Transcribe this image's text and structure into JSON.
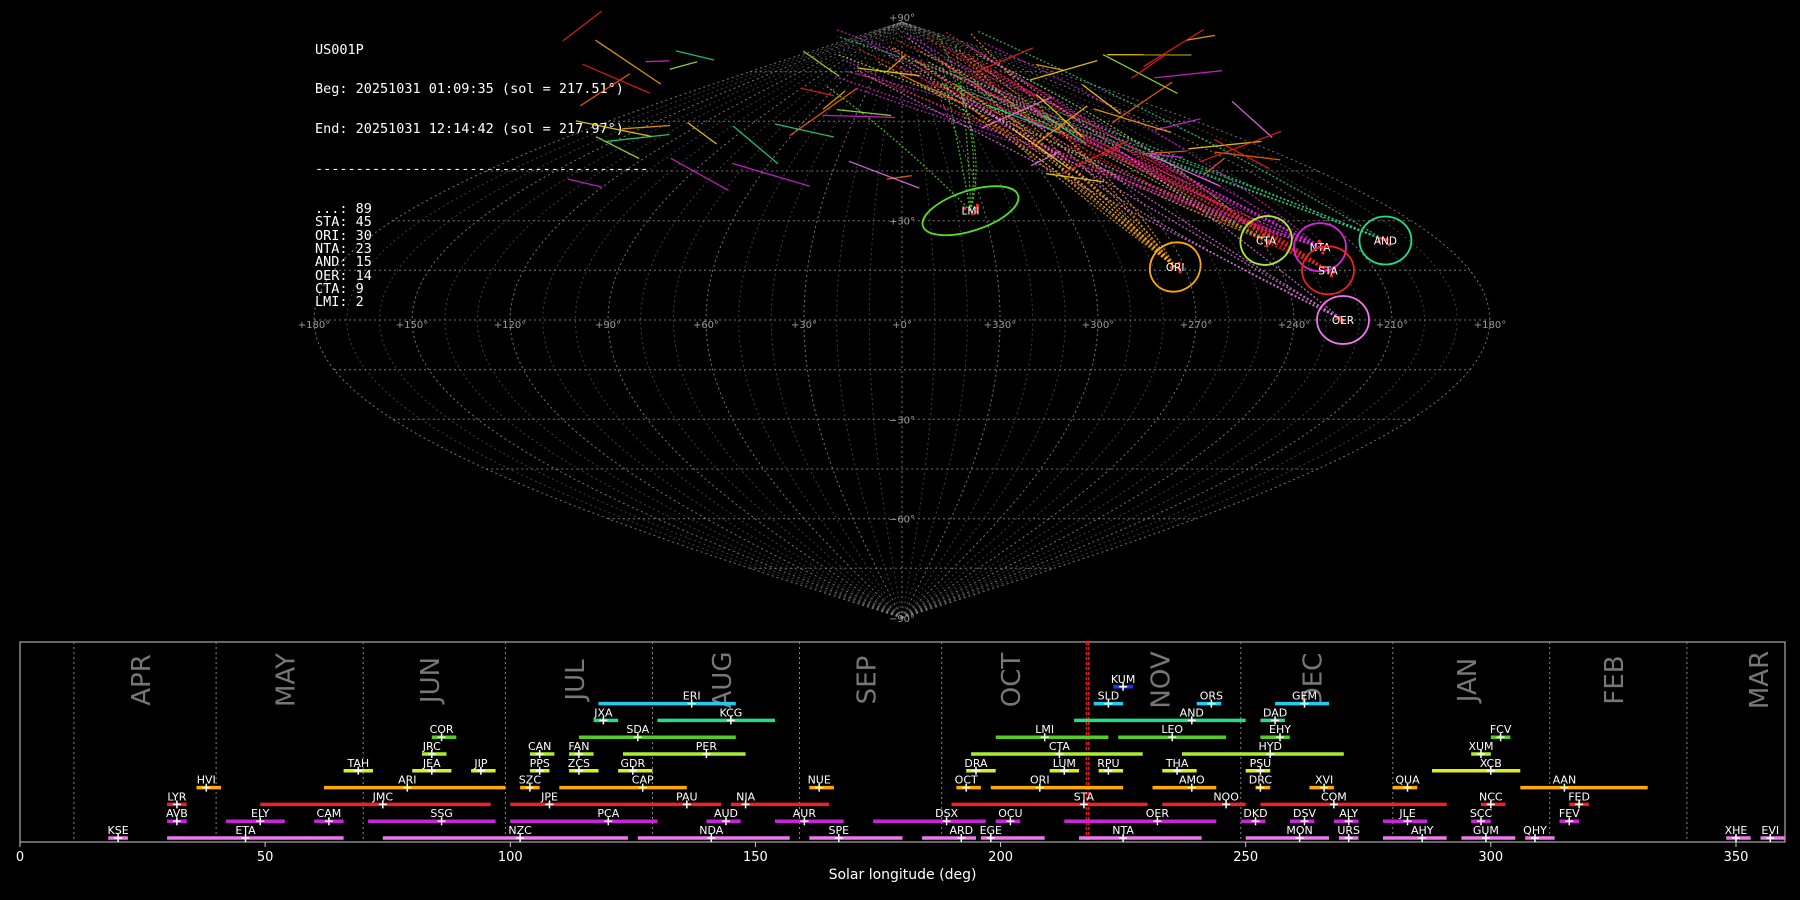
{
  "header": {
    "station": "US001P",
    "begin": "Beg: 20251031 01:09:35 (sol = 217.51°)",
    "end": "End: 20251031 12:14:42 (sol = 217.97°)",
    "separator": "-----------------------------------------",
    "counts": [
      {
        "code": "...",
        "count": 89
      },
      {
        "code": "STA",
        "count": 45
      },
      {
        "code": "ORI",
        "count": 30
      },
      {
        "code": "NTA",
        "count": 23
      },
      {
        "code": "AND",
        "count": 15
      },
      {
        "code": "OER",
        "count": 14
      },
      {
        "code": "CTA",
        "count": 9
      },
      {
        "code": "LMI",
        "count": 2
      }
    ]
  },
  "sky_map": {
    "projection": "sinusoidal",
    "longitude_ticks": [
      "+180°",
      "+150°",
      "+120°",
      "+90°",
      "+60°",
      "+30°",
      "+0°",
      "+330°",
      "+300°",
      "+270°",
      "+240°",
      "+210°",
      "+180°"
    ],
    "latitude_ticks": [
      "+90°",
      "+30°",
      "−30°",
      "−60°",
      "−90°"
    ],
    "radiants": [
      {
        "code": "LMI",
        "lon": 155,
        "lat": 33,
        "color": "#55dd22"
      },
      {
        "code": "ORI",
        "lon": 93,
        "lat": 16,
        "color": "#ffaa00"
      },
      {
        "code": "CTA",
        "lon": 58,
        "lat": 24,
        "color": "#aaee33"
      },
      {
        "code": "NTA",
        "lon": 42,
        "lat": 22,
        "color": "#dd22dd"
      },
      {
        "code": "STA",
        "lon": 45,
        "lat": 15,
        "color": "#ee2222"
      },
      {
        "code": "AND",
        "lon": 18,
        "lat": 24,
        "color": "#22dd88"
      },
      {
        "code": "OER",
        "lon": 45,
        "lat": 0,
        "color": "#ee77ee"
      }
    ]
  },
  "chart_data": {
    "type": "timeline",
    "xlabel": "Solar longitude (deg)",
    "xlim": [
      0,
      360
    ],
    "xticks": [
      0,
      50,
      100,
      150,
      200,
      250,
      300,
      350
    ],
    "current_sol": [
      217.51,
      217.97
    ],
    "months": [
      {
        "label": "APR",
        "start": 11
      },
      {
        "label": "MAY",
        "start": 40
      },
      {
        "label": "JUN",
        "start": 70
      },
      {
        "label": "JUL",
        "start": 99
      },
      {
        "label": "AUG",
        "start": 129
      },
      {
        "label": "SEP",
        "start": 159
      },
      {
        "label": "OCT",
        "start": 188
      },
      {
        "label": "NOV",
        "start": 218
      },
      {
        "label": "DEC",
        "start": 249
      },
      {
        "label": "JAN",
        "start": 280
      },
      {
        "label": "FEB",
        "start": 312
      },
      {
        "label": "MAR",
        "start": 340
      }
    ],
    "showers": [
      {
        "code": "KUM",
        "start": 223,
        "end": 227,
        "peak": 225,
        "row": 10,
        "color": "#2233ff"
      },
      {
        "code": "ERI",
        "start": 118,
        "end": 146,
        "peak": 137,
        "row": 9,
        "color": "#22ccee"
      },
      {
        "code": "SLD",
        "start": 219,
        "end": 225,
        "peak": 222,
        "row": 9,
        "color": "#22ccee"
      },
      {
        "code": "ORS",
        "start": 240,
        "end": 245,
        "peak": 243,
        "row": 9,
        "color": "#22ccee"
      },
      {
        "code": "GEM",
        "start": 256,
        "end": 267,
        "peak": 262,
        "row": 9,
        "color": "#22ccee"
      },
      {
        "code": "JXA",
        "start": 117,
        "end": 122,
        "peak": 119,
        "row": 8,
        "color": "#22dd88"
      },
      {
        "code": "KCG",
        "start": 130,
        "end": 154,
        "peak": 145,
        "row": 8,
        "color": "#22dd88"
      },
      {
        "code": "AND",
        "start": 215,
        "end": 250,
        "peak": 239,
        "row": 8,
        "color": "#22dd88"
      },
      {
        "code": "DAD",
        "start": 253,
        "end": 258,
        "peak": 256,
        "row": 8,
        "color": "#22dd88"
      },
      {
        "code": "COR",
        "start": 84,
        "end": 89,
        "peak": 86,
        "row": 7,
        "color": "#55cc22"
      },
      {
        "code": "SDA",
        "start": 114,
        "end": 146,
        "peak": 126,
        "row": 7,
        "color": "#55cc22"
      },
      {
        "code": "LMI",
        "start": 199,
        "end": 222,
        "peak": 209,
        "row": 7,
        "color": "#55cc22"
      },
      {
        "code": "LEO",
        "start": 224,
        "end": 246,
        "peak": 235,
        "row": 7,
        "color": "#55cc22"
      },
      {
        "code": "EHY",
        "start": 253,
        "end": 259,
        "peak": 257,
        "row": 7,
        "color": "#55cc22"
      },
      {
        "code": "FCV",
        "start": 300,
        "end": 304,
        "peak": 302,
        "row": 7,
        "color": "#55cc22"
      },
      {
        "code": "JRC",
        "start": 82,
        "end": 87,
        "peak": 84,
        "row": 6,
        "color": "#aaee33"
      },
      {
        "code": "CAN",
        "start": 104,
        "end": 109,
        "peak": 106,
        "row": 6,
        "color": "#aaee33"
      },
      {
        "code": "FAN",
        "start": 112,
        "end": 117,
        "peak": 114,
        "row": 6,
        "color": "#aaee33"
      },
      {
        "code": "PER",
        "start": 123,
        "end": 148,
        "peak": 140,
        "row": 6,
        "color": "#aaee33"
      },
      {
        "code": "CTA",
        "start": 194,
        "end": 229,
        "peak": 212,
        "row": 6,
        "color": "#aaee33"
      },
      {
        "code": "HYD",
        "start": 237,
        "end": 270,
        "peak": 255,
        "row": 6,
        "color": "#aaee33"
      },
      {
        "code": "XUM",
        "start": 296,
        "end": 300,
        "peak": 298,
        "row": 6,
        "color": "#aaee33"
      },
      {
        "code": "TAH",
        "start": 66,
        "end": 72,
        "peak": 69,
        "row": 5,
        "color": "#ddee22"
      },
      {
        "code": "JEA",
        "start": 80,
        "end": 88,
        "peak": 84,
        "row": 5,
        "color": "#ddee22"
      },
      {
        "code": "JIP",
        "start": 92,
        "end": 97,
        "peak": 94,
        "row": 5,
        "color": "#ddee22"
      },
      {
        "code": "PPS",
        "start": 104,
        "end": 108,
        "peak": 106,
        "row": 5,
        "color": "#ddee22"
      },
      {
        "code": "ZCS",
        "start": 112,
        "end": 118,
        "peak": 114,
        "row": 5,
        "color": "#ddee22"
      },
      {
        "code": "GDR",
        "start": 122,
        "end": 129,
        "peak": 125,
        "row": 5,
        "color": "#ddee22"
      },
      {
        "code": "DRA",
        "start": 193,
        "end": 199,
        "peak": 195,
        "row": 5,
        "color": "#ddee22"
      },
      {
        "code": "LUM",
        "start": 210,
        "end": 216,
        "peak": 213,
        "row": 5,
        "color": "#ddee22"
      },
      {
        "code": "RPU",
        "start": 220,
        "end": 225,
        "peak": 222,
        "row": 5,
        "color": "#ddee22"
      },
      {
        "code": "THA",
        "start": 233,
        "end": 240,
        "peak": 236,
        "row": 5,
        "color": "#ddee22"
      },
      {
        "code": "PSU",
        "start": 250,
        "end": 255,
        "peak": 253,
        "row": 5,
        "color": "#ddee22"
      },
      {
        "code": "XCB",
        "start": 288,
        "end": 306,
        "peak": 300,
        "row": 5,
        "color": "#ddee22"
      },
      {
        "code": "HVI",
        "start": 36,
        "end": 41,
        "peak": 38,
        "row": 4,
        "color": "#ffaa00"
      },
      {
        "code": "ARI",
        "start": 62,
        "end": 99,
        "peak": 79,
        "row": 4,
        "color": "#ffaa00"
      },
      {
        "code": "SZC",
        "start": 102,
        "end": 106,
        "peak": 104,
        "row": 4,
        "color": "#ffaa00"
      },
      {
        "code": "CAP",
        "start": 110,
        "end": 136,
        "peak": 127,
        "row": 4,
        "color": "#ffaa00"
      },
      {
        "code": "NUE",
        "start": 161,
        "end": 166,
        "peak": 163,
        "row": 4,
        "color": "#ffaa00"
      },
      {
        "code": "OCT",
        "start": 191,
        "end": 196,
        "peak": 193,
        "row": 4,
        "color": "#ffaa00"
      },
      {
        "code": "ORI",
        "start": 198,
        "end": 225,
        "peak": 208,
        "row": 4,
        "color": "#ffaa00"
      },
      {
        "code": "AMO",
        "start": 231,
        "end": 244,
        "peak": 239,
        "row": 4,
        "color": "#ffaa00"
      },
      {
        "code": "DRC",
        "start": 252,
        "end": 255,
        "peak": 253,
        "row": 4,
        "color": "#ffaa00"
      },
      {
        "code": "XVI",
        "start": 263,
        "end": 268,
        "peak": 266,
        "row": 4,
        "color": "#ffaa00"
      },
      {
        "code": "QUA",
        "start": 280,
        "end": 285,
        "peak": 283,
        "row": 4,
        "color": "#ffaa00"
      },
      {
        "code": "AAN",
        "start": 306,
        "end": 332,
        "peak": 315,
        "row": 4,
        "color": "#ffaa00"
      },
      {
        "code": "LYR",
        "start": 30,
        "end": 34,
        "peak": 32,
        "row": 3,
        "color": "#ee2222"
      },
      {
        "code": "JMC",
        "start": 49,
        "end": 96,
        "peak": 74,
        "row": 3,
        "color": "#ee2222"
      },
      {
        "code": "JPE",
        "start": 100,
        "end": 122,
        "peak": 108,
        "row": 3,
        "color": "#ee2222"
      },
      {
        "code": "PAU",
        "start": 122,
        "end": 143,
        "peak": 136,
        "row": 3,
        "color": "#ee2222"
      },
      {
        "code": "NIA",
        "start": 145,
        "end": 165,
        "peak": 148,
        "row": 3,
        "color": "#ee2222"
      },
      {
        "code": "STA",
        "start": 190,
        "end": 230,
        "peak": 217,
        "row": 3,
        "color": "#ee2222"
      },
      {
        "code": "NOO",
        "start": 233,
        "end": 250,
        "peak": 246,
        "row": 3,
        "color": "#ee2222"
      },
      {
        "code": "COM",
        "start": 253,
        "end": 291,
        "peak": 268,
        "row": 3,
        "color": "#ee2222"
      },
      {
        "code": "NCC",
        "start": 298,
        "end": 303,
        "peak": 300,
        "row": 3,
        "color": "#ee2222"
      },
      {
        "code": "FED",
        "start": 316,
        "end": 320,
        "peak": 318,
        "row": 3,
        "color": "#ee2222"
      },
      {
        "code": "AVB",
        "start": 30,
        "end": 34,
        "peak": 32,
        "row": 2,
        "color": "#cc22dd"
      },
      {
        "code": "ELY",
        "start": 42,
        "end": 54,
        "peak": 49,
        "row": 2,
        "color": "#cc22dd"
      },
      {
        "code": "CAM",
        "start": 60,
        "end": 66,
        "peak": 63,
        "row": 2,
        "color": "#cc22dd"
      },
      {
        "code": "SSG",
        "start": 71,
        "end": 97,
        "peak": 86,
        "row": 2,
        "color": "#cc22dd"
      },
      {
        "code": "PCA",
        "start": 100,
        "end": 130,
        "peak": 120,
        "row": 2,
        "color": "#cc22dd"
      },
      {
        "code": "AUD",
        "start": 140,
        "end": 147,
        "peak": 144,
        "row": 2,
        "color": "#cc22dd"
      },
      {
        "code": "AUR",
        "start": 154,
        "end": 168,
        "peak": 160,
        "row": 2,
        "color": "#cc22dd"
      },
      {
        "code": "DSX",
        "start": 174,
        "end": 197,
        "peak": 189,
        "row": 2,
        "color": "#cc22dd"
      },
      {
        "code": "OCU",
        "start": 199,
        "end": 204,
        "peak": 202,
        "row": 2,
        "color": "#cc22dd"
      },
      {
        "code": "OER",
        "start": 213,
        "end": 244,
        "peak": 232,
        "row": 2,
        "color": "#cc22dd"
      },
      {
        "code": "DKD",
        "start": 249,
        "end": 254,
        "peak": 252,
        "row": 2,
        "color": "#cc22dd"
      },
      {
        "code": "DSV",
        "start": 259,
        "end": 264,
        "peak": 262,
        "row": 2,
        "color": "#cc22dd"
      },
      {
        "code": "ALY",
        "start": 268,
        "end": 273,
        "peak": 271,
        "row": 2,
        "color": "#cc22dd"
      },
      {
        "code": "JLE",
        "start": 278,
        "end": 287,
        "peak": 283,
        "row": 2,
        "color": "#cc22dd"
      },
      {
        "code": "SCC",
        "start": 296,
        "end": 300,
        "peak": 298,
        "row": 2,
        "color": "#cc22dd"
      },
      {
        "code": "FEV",
        "start": 314,
        "end": 318,
        "peak": 316,
        "row": 2,
        "color": "#cc22dd"
      },
      {
        "code": "KSE",
        "start": 18,
        "end": 22,
        "peak": 20,
        "row": 1,
        "color": "#ee77ee"
      },
      {
        "code": "ETA",
        "start": 30,
        "end": 66,
        "peak": 46,
        "row": 1,
        "color": "#ee77ee"
      },
      {
        "code": "NZC",
        "start": 74,
        "end": 124,
        "peak": 102,
        "row": 1,
        "color": "#ee77ee"
      },
      {
        "code": "NDA",
        "start": 126,
        "end": 157,
        "peak": 141,
        "row": 1,
        "color": "#ee77ee"
      },
      {
        "code": "SPE",
        "start": 161,
        "end": 180,
        "peak": 167,
        "row": 1,
        "color": "#ee77ee"
      },
      {
        "code": "ARD",
        "start": 184,
        "end": 195,
        "peak": 192,
        "row": 1,
        "color": "#ee77ee"
      },
      {
        "code": "EGE",
        "start": 196,
        "end": 209,
        "peak": 198,
        "row": 1,
        "color": "#ee77ee"
      },
      {
        "code": "NTA",
        "start": 216,
        "end": 241,
        "peak": 225,
        "row": 1,
        "color": "#ee77ee"
      },
      {
        "code": "MON",
        "start": 250,
        "end": 267,
        "peak": 261,
        "row": 1,
        "color": "#ee77ee"
      },
      {
        "code": "URS",
        "start": 269,
        "end": 273,
        "peak": 271,
        "row": 1,
        "color": "#ee77ee"
      },
      {
        "code": "AHY",
        "start": 278,
        "end": 291,
        "peak": 286,
        "row": 1,
        "color": "#ee77ee"
      },
      {
        "code": "GUM",
        "start": 294,
        "end": 305,
        "peak": 299,
        "row": 1,
        "color": "#ee77ee"
      },
      {
        "code": "QHY",
        "start": 307,
        "end": 313,
        "peak": 309,
        "row": 1,
        "color": "#ee77ee"
      },
      {
        "code": "XHE",
        "start": 348,
        "end": 353,
        "peak": 350,
        "row": 1,
        "color": "#ee77ee"
      },
      {
        "code": "EVI",
        "start": 355,
        "end": 360,
        "peak": 357,
        "row": 1,
        "color": "#ee77ee"
      }
    ]
  }
}
